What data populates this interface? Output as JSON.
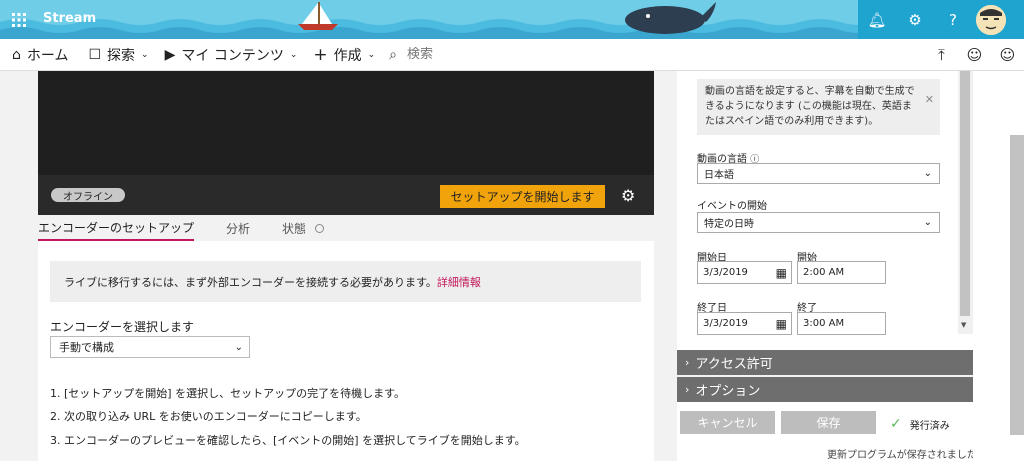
{
  "header": {
    "brand": "Stream",
    "icons": [
      "waffle-icon",
      "bell-icon",
      "gear-icon",
      "help-icon",
      "avatar"
    ]
  },
  "nav": {
    "items": [
      {
        "label": "ホーム",
        "icon": "home-icon"
      },
      {
        "label": "探索",
        "icon": "explore-icon",
        "dropdown": true
      },
      {
        "label": "マイ コンテンツ",
        "icon": "video-icon",
        "dropdown": true
      },
      {
        "label": "作成",
        "icon": "plus-icon",
        "dropdown": true
      }
    ],
    "search_placeholder": "検索",
    "right_icons": [
      "upload-icon",
      "person-add-icon",
      "smiley-icon"
    ]
  },
  "player": {
    "status_badge": "オフライン",
    "setup_button": "セットアップを開始します"
  },
  "tabs": [
    "エンコーダーのセットアップ",
    "分析",
    "状態"
  ],
  "setup": {
    "info_text": "ライブに移行するには、まず外部エンコーダーを接続する必要があります。",
    "info_link": "詳細情報",
    "encoder_label": "エンコーダーを選択します",
    "encoder_value": "手動で構成",
    "steps": [
      "1. [セットアップを開始] を選択し、セットアップの完了を待機します。",
      "2. 次の取り込み URL をお使いのエンコーダーにコピーします。",
      "3. エンコーダーのプレビューを確認したら、[イベントの開始] を選択してライブを開始します。"
    ]
  },
  "details": {
    "notice": "動画の言語を設定すると、字幕を自動で生成できるようになります (この機能は現在、英語またはスペイン語でのみ利用できます)。",
    "language_label": "動画の言語",
    "language_value": "日本語",
    "event_start_label": "イベントの開始",
    "event_start_value": "特定の日時",
    "start_date_label": "開始日",
    "start_date": "3/3/2019",
    "start_time_label": "開始",
    "start_time": "2:00 AM",
    "end_date_label": "終了日",
    "end_date": "3/3/2019",
    "end_time_label": "終了",
    "end_time": "3:00 AM"
  },
  "sections": [
    "アクセス許可",
    "オプション"
  ],
  "footer": {
    "cancel": "キャンセル",
    "save": "保存",
    "published": "発行済み",
    "saved_note": "更新プログラムが保存されました"
  },
  "colors": {
    "accent": "#f0a30a",
    "link": "#c2185b",
    "header": "#1fa4cf",
    "banner": "#6fcde8"
  }
}
